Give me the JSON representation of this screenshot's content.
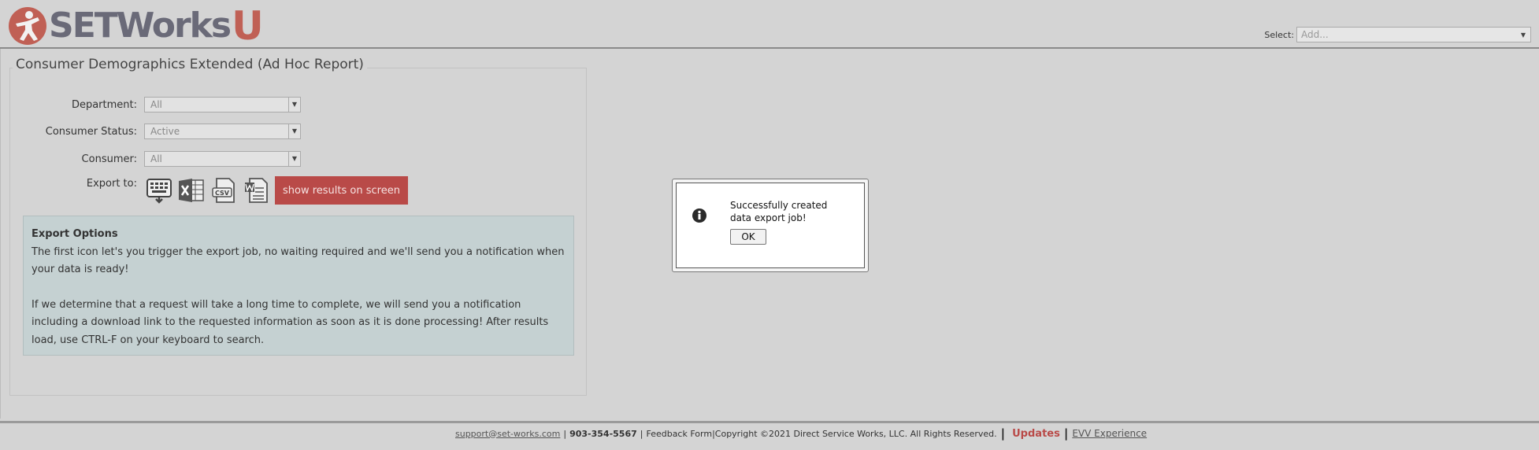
{
  "header": {
    "logo_text": "SETWorks",
    "logo_suffix": "U",
    "select_label": "Select:",
    "select_placeholder": "Add..."
  },
  "report": {
    "title": "Consumer Demographics Extended (Ad Hoc Report)",
    "fields": [
      {
        "label": "Department:",
        "value": "All"
      },
      {
        "label": "Consumer Status:",
        "value": "Active"
      },
      {
        "label": "Consumer:",
        "value": "All"
      }
    ],
    "export_label": "Export to:",
    "export_icons": [
      "export-job-icon",
      "excel-icon",
      "csv-icon",
      "word-icon"
    ],
    "show_results_label": "show results on screen"
  },
  "export_options": {
    "title": "Export Options",
    "para1": "The first icon let's you trigger the export job, no waiting required and we'll send you a notification when your data is ready!",
    "para2": "If we determine that a request will take a long time to complete, we will send you a notification including a download link to the requested information as soon as it is done processing! After results load, use CTRL-F on your keyboard to search."
  },
  "dialog": {
    "message": "Successfully created data export job!",
    "ok_label": "OK"
  },
  "footer": {
    "email": "support@set-works.com",
    "phone": "903-354-5567",
    "feedback": "Feedback Form",
    "copyright": "Copyright ©2021 Direct Service Works, LLC. All Rights Reserved.",
    "updates": "Updates",
    "evv": "EVV Experience"
  },
  "colors": {
    "background": "#d4d4d4",
    "accent_red": "#b94a48",
    "info_box": "#c5d1d2",
    "logo_gray": "#6a6a78"
  }
}
